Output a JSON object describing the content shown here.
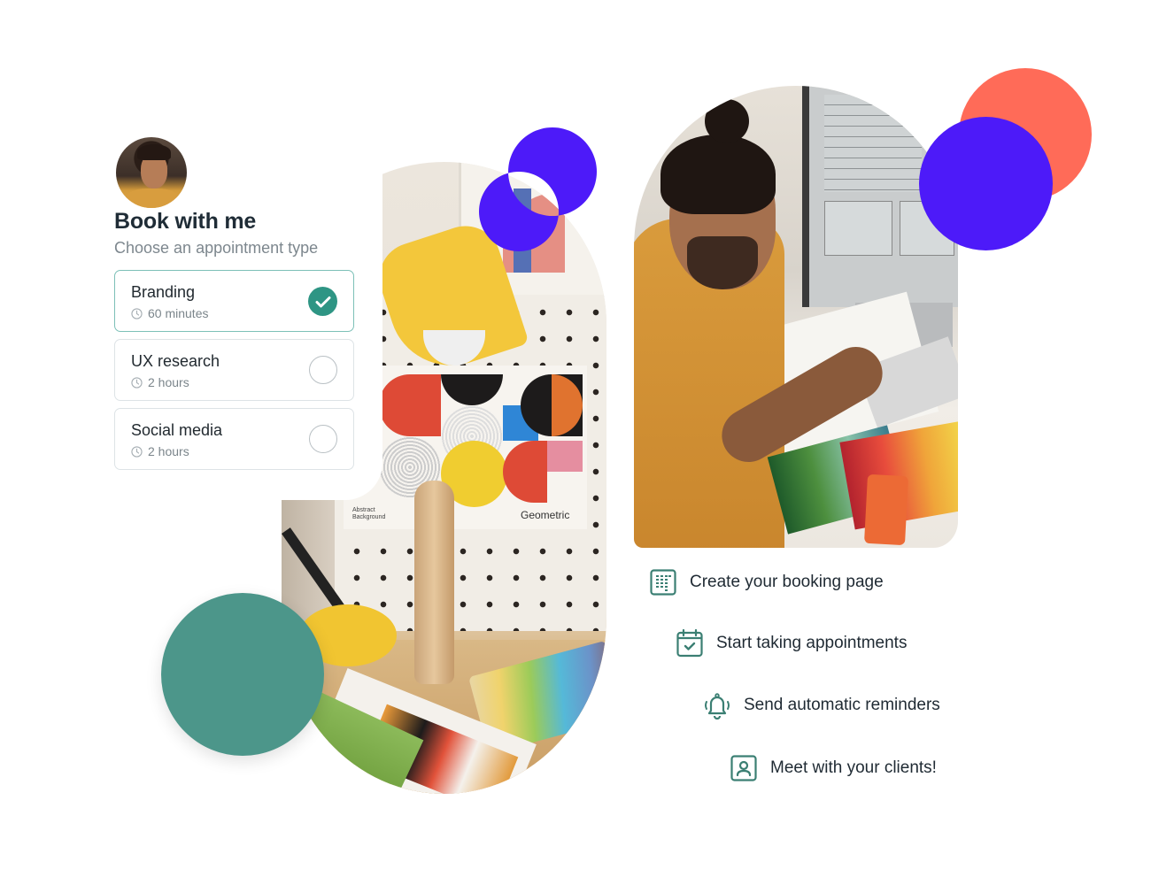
{
  "booking_card": {
    "avatar": "profile-photo",
    "title": "Book with me",
    "subtitle": "Choose an appointment type",
    "options": [
      {
        "label": "Branding",
        "duration": "60 minutes",
        "selected": true
      },
      {
        "label": "UX research",
        "duration": "2 hours",
        "selected": false
      },
      {
        "label": "Social media",
        "duration": "2 hours",
        "selected": false
      }
    ]
  },
  "features": [
    {
      "icon": "booking-page-icon",
      "label": "Create your booking page"
    },
    {
      "icon": "calendar-check-icon",
      "label": "Start taking appointments"
    },
    {
      "icon": "bell-icon",
      "label": "Send automatic reminders"
    },
    {
      "icon": "user-portrait-icon",
      "label": "Meet with your clients!"
    }
  ],
  "photos": {
    "left_poster_caption": "Geometric",
    "left_poster_subcaption_1": "Abstract",
    "left_poster_subcaption_2": "Background"
  },
  "colors": {
    "accent_teal": "#2e9584",
    "icon_teal": "#3b7f73",
    "circle_teal": "#4c968a",
    "purple": "#4d1af9",
    "coral": "#ff6b58",
    "title_text": "#1f2c36",
    "muted_text": "#7d878e"
  }
}
